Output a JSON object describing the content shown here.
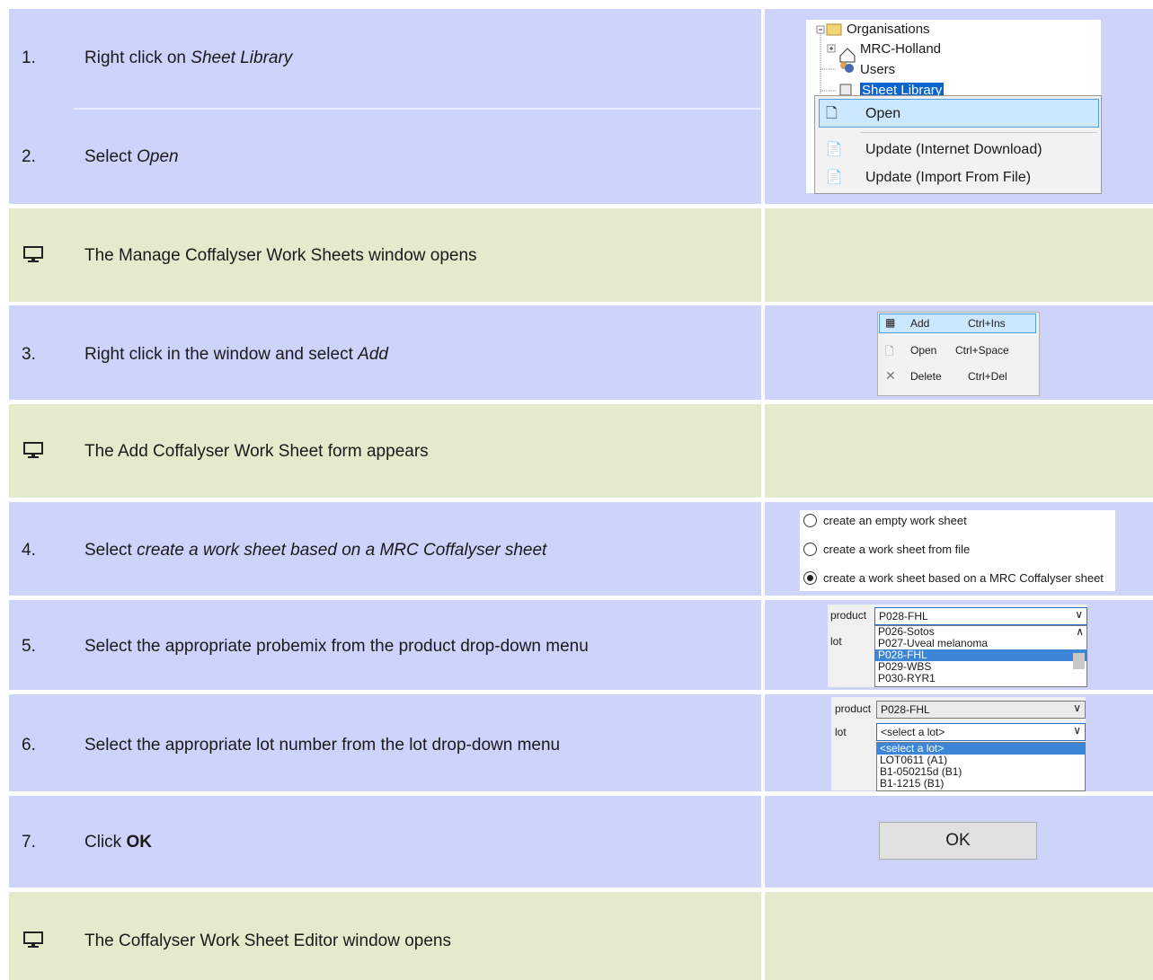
{
  "steps": [
    {
      "num": "1.",
      "text": "Right click on ",
      "em": "Sheet Library"
    },
    {
      "num": "2.",
      "text": "Select ",
      "em": "Open"
    },
    {
      "text": "The Manage Coffalyser Work Sheets window opens"
    },
    {
      "num": "3.",
      "text": "Right click in the window and select ",
      "em": "Add"
    },
    {
      "text": "The Add Coffalyser Work Sheet form appears"
    },
    {
      "num": "4.",
      "text": "Select ",
      "em": "create a work sheet based on a MRC Coffalyser sheet"
    },
    {
      "num": "5.",
      "text": "Select the appropriate probemix from the product drop-down menu"
    },
    {
      "num": "6.",
      "text": "Select the appropriate lot number from the lot drop-down menu"
    },
    {
      "num": "7.",
      "text": "Click ",
      "strong": "OK"
    },
    {
      "text": "The Coffalyser Work Sheet Editor window opens"
    }
  ],
  "tree": {
    "items": [
      "Organisations",
      "MRC-Holland",
      "Users",
      "Sheet Library"
    ],
    "context_menu": [
      "Open",
      "Update (Internet Download)",
      "Update (Import From File)"
    ]
  },
  "menu2": {
    "items": [
      {
        "label": "Add",
        "shortcut": "Ctrl+Ins"
      },
      {
        "label": "Open",
        "shortcut": "Ctrl+Space"
      },
      {
        "label": "Delete",
        "shortcut": "Ctrl+Del"
      }
    ]
  },
  "radios": {
    "options": [
      "create an empty work sheet",
      "create a work sheet from file",
      "create a work sheet based on a MRC Coffalyser sheet"
    ],
    "selected_index": 2
  },
  "product_form": {
    "product_label": "product",
    "lot_label": "lot",
    "product_value": "P028-FHL",
    "product_options": [
      "P026-Sotos",
      "P027-Uveal melanoma",
      "P028-FHL",
      "P029-WBS",
      "P030-RYR1"
    ],
    "selected_product": "P028-FHL"
  },
  "lot_form": {
    "product_label": "product",
    "lot_label": "lot",
    "product_value": "P028-FHL",
    "lot_value": "<select a lot>",
    "lot_options": [
      "<select a lot>",
      "LOT0611 (A1)",
      "B1-050215d (B1)",
      "B1-1215 (B1)"
    ]
  },
  "ok_button": "OK",
  "colors": {
    "step_bg": "#cdd3fb",
    "result_bg": "#e4eacc",
    "selection": "#3b86d8"
  }
}
